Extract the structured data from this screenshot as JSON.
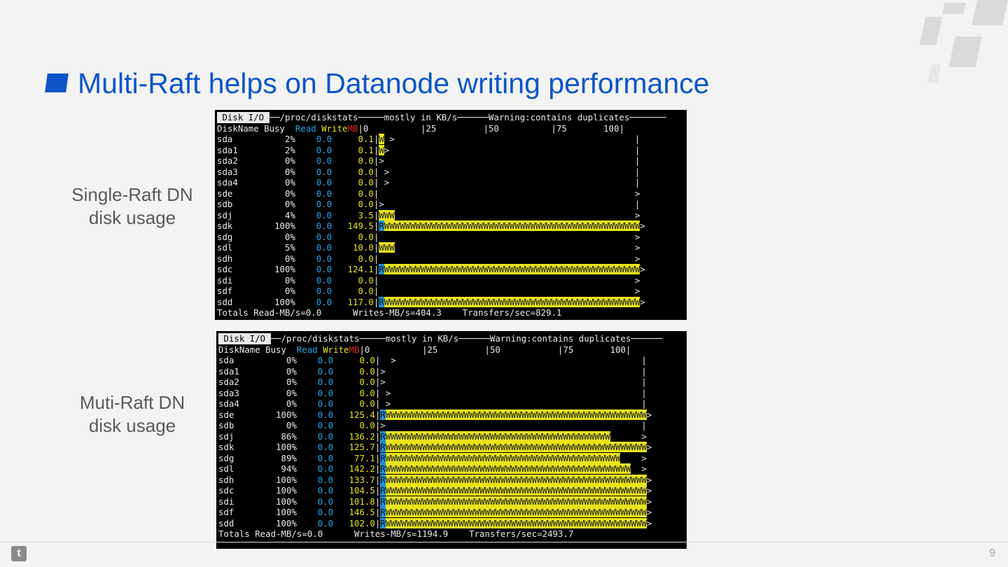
{
  "slide": {
    "title": "Multi-Raft helps on Datanode writing performance",
    "page_number": "9",
    "accent_color": "#0b55c9"
  },
  "panels": [
    {
      "label": "Single-Raft DN\ndisk usage",
      "header": {
        "tab": "Disk I/O",
        "rest": "──/proc/diskstats─────mostly in KB/s──────Warning:contains duplicates───────"
      },
      "columns": {
        "name": "DiskName",
        "busy": "Busy",
        "read": "Read",
        "write": "Write",
        "unit": "MB",
        "scale": "|0          |25         |50          |75       100|"
      },
      "rows": [
        {
          "disk": "sda",
          "busy": "2%",
          "read": "0.0",
          "write": "0.1",
          "bar": "W",
          "tail": " >"
        },
        {
          "disk": "sda1",
          "busy": "2%",
          "read": "0.0",
          "write": "0.1",
          "bar": "W",
          "tail": ">"
        },
        {
          "disk": "sda2",
          "busy": "0%",
          "read": "0.0",
          "write": "0.0",
          "bar": "",
          "tail": ">"
        },
        {
          "disk": "sda3",
          "busy": "0%",
          "read": "0.0",
          "write": "0.0",
          "bar": "",
          "tail": " >"
        },
        {
          "disk": "sda4",
          "busy": "0%",
          "read": "0.0",
          "write": "0.0",
          "bar": "",
          "tail": " >"
        },
        {
          "disk": "sde",
          "busy": "0%",
          "read": "0.0",
          "write": "0.0",
          "bar": "",
          "tail": ""
        },
        {
          "disk": "sdb",
          "busy": "0%",
          "read": "0.0",
          "write": "0.0",
          "bar": "",
          "tail": ">"
        },
        {
          "disk": "sdj",
          "busy": "4%",
          "read": "0.0",
          "write": "3.5",
          "bar": "WWW",
          "tail": ""
        },
        {
          "disk": "sdk",
          "busy": "100%",
          "read": "0.0",
          "write": "149.5",
          "bar": "RWWWWWWWWWWWWWWWWWWWWWWWWWWWWWWWWWWWWWWWWWWWWWWWWW",
          "tail": ">"
        },
        {
          "disk": "sdg",
          "busy": "0%",
          "read": "0.0",
          "write": "0.0",
          "bar": "",
          "tail": ""
        },
        {
          "disk": "sdl",
          "busy": "5%",
          "read": "0.0",
          "write": "10.0",
          "bar": "WWW",
          "tail": ""
        },
        {
          "disk": "sdh",
          "busy": "0%",
          "read": "0.0",
          "write": "0.0",
          "bar": "",
          "tail": ""
        },
        {
          "disk": "sdc",
          "busy": "100%",
          "read": "0.0",
          "write": "124.1",
          "bar": "RWWWWWWWWWWWWWWWWWWWWWWWWWWWWWWWWWWWWWWWWWWWWWWWWW",
          "tail": ">"
        },
        {
          "disk": "sdi",
          "busy": "0%",
          "read": "0.0",
          "write": "0.0",
          "bar": "",
          "tail": ""
        },
        {
          "disk": "sdf",
          "busy": "0%",
          "read": "0.0",
          "write": "0.0",
          "bar": "",
          "tail": ""
        },
        {
          "disk": "sdd",
          "busy": "100%",
          "read": "0.0",
          "write": "117.0",
          "bar": "RWWWWWWWWWWWWWWWWWWWWWWWWWWWWWWWWWWWWWWWWWWWWWWWWW",
          "tail": ">"
        }
      ],
      "edge_marks": [
        "|",
        "|",
        "|",
        "|",
        "|",
        ">",
        "|",
        ">",
        "",
        ">",
        ">",
        ">",
        "",
        ">",
        ">",
        ""
      ],
      "totals": {
        "read": "Totals Read-MB/s=0.0",
        "writes": "Writes-MB/s=404.3",
        "transfers": "Transfers/sec=829.1"
      }
    },
    {
      "label": "Muti-Raft DN\ndisk usage",
      "header": {
        "tab": "Disk I/O",
        "rest": "──/proc/diskstats─────mostly in KB/s──────Warning:contains duplicates──────"
      },
      "columns": {
        "name": "DiskName",
        "busy": "Busy",
        "read": "Read",
        "write": "Write",
        "unit": "MB",
        "scale": "|0          |25         |50           |75       100|"
      },
      "rows": [
        {
          "disk": "sda",
          "busy": "0%",
          "read": "0.0",
          "write": "0.0",
          "bar": "",
          "tail": "  >"
        },
        {
          "disk": "sda1",
          "busy": "0%",
          "read": "0.0",
          "write": "0.0",
          "bar": "",
          "tail": ">"
        },
        {
          "disk": "sda2",
          "busy": "0%",
          "read": "0.0",
          "write": "0.0",
          "bar": "",
          "tail": ">"
        },
        {
          "disk": "sda3",
          "busy": "0%",
          "read": "0.0",
          "write": "0.0",
          "bar": "",
          "tail": " >"
        },
        {
          "disk": "sda4",
          "busy": "0%",
          "read": "0.0",
          "write": "0.0",
          "bar": "",
          "tail": " >"
        },
        {
          "disk": "sde",
          "busy": "100%",
          "read": "0.0",
          "write": "125.4",
          "bar": "RWWWWWWWWWWWWWWWWWWWWWWWWWWWWWWWWWWWWWWWWWWWWWWWWWW",
          "tail": ">"
        },
        {
          "disk": "sdb",
          "busy": "0%",
          "read": "0.0",
          "write": "0.0",
          "bar": "",
          "tail": ">"
        },
        {
          "disk": "sdj",
          "busy": "86%",
          "read": "0.0",
          "write": "136.2",
          "bar": "RWWWWWWWWWWWWWWWWWWWWWWWWWWWWWWWWWWWWWWWWWWW",
          "tail": ""
        },
        {
          "disk": "sdk",
          "busy": "100%",
          "read": "0.0",
          "write": "125.7",
          "bar": "RWWWWWWWWWWWWWWWWWWWWWWWWWWWWWWWWWWWWWWWWWWWWWWWWWW",
          "tail": ">"
        },
        {
          "disk": "sdg",
          "busy": "89%",
          "read": "0.0",
          "write": "77.1",
          "bar": "RWWWWWWWWWWWWWWWWWWWWWWWWWWWWWWWWWWWWWWWWWWWWW",
          "tail": ""
        },
        {
          "disk": "sdl",
          "busy": "94%",
          "read": "0.0",
          "write": "142.2",
          "bar": "RWWWWWWWWWWWWWWWWWWWWWWWWWWWWWWWWWWWWWWWWWWWWWWW",
          "tail": ""
        },
        {
          "disk": "sdh",
          "busy": "100%",
          "read": "0.0",
          "write": "133.7",
          "bar": "RWWWWWWWWWWWWWWWWWWWWWWWWWWWWWWWWWWWWWWWWWWWWWWWWWW",
          "tail": ">"
        },
        {
          "disk": "sdc",
          "busy": "100%",
          "read": "0.0",
          "write": "104.5",
          "bar": "RWWWWWWWWWWWWWWWWWWWWWWWWWWWWWWWWWWWWWWWWWWWWWWWWWW",
          "tail": ">"
        },
        {
          "disk": "sdi",
          "busy": "100%",
          "read": "0.0",
          "write": "101.8",
          "bar": "RWWWWWWWWWWWWWWWWWWWWWWWWWWWWWWWWWWWWWWWWWWWWWWWWWW",
          "tail": ">"
        },
        {
          "disk": "sdf",
          "busy": "100%",
          "read": "0.0",
          "write": "146.5",
          "bar": "RWWWWWWWWWWWWWWWWWWWWWWWWWWWWWWWWWWWWWWWWWWWWWWWWWW",
          "tail": ">"
        },
        {
          "disk": "sdd",
          "busy": "100%",
          "read": "0.0",
          "write": "102.0",
          "bar": "RWWWWWWWWWWWWWWWWWWWWWWWWWWWWWWWWWWWWWWWWWWWWWWWWWW",
          "tail": ">"
        }
      ],
      "edge_marks": [
        "|",
        "|",
        "|",
        "|",
        "|",
        "",
        "|",
        ">",
        "",
        ">",
        ">",
        "",
        "",
        "",
        "",
        ""
      ],
      "totals": {
        "read": "Totals Read-MB/s=0.0",
        "writes": "Writes-MB/s=1194.9",
        "transfers": "Transfers/sec=2493.7"
      }
    }
  ]
}
